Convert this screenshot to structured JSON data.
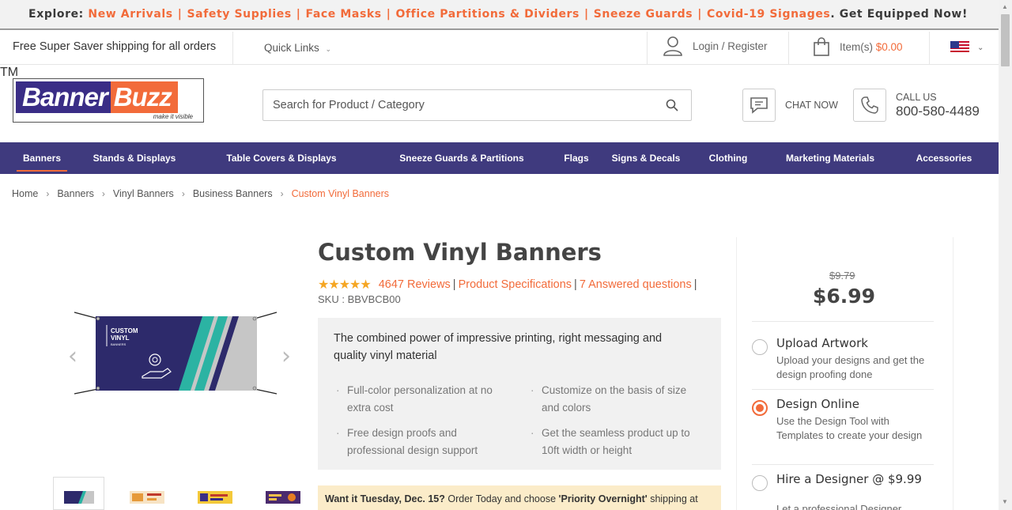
{
  "topbar": {
    "explore": "Explore:",
    "links": [
      "New Arrivals",
      "Safety Supplies",
      "Face Masks",
      "Office Partitions & Dividers",
      "Sneeze Guards",
      "Covid-19 Signages"
    ],
    "cta": "Get Equipped Now!"
  },
  "util": {
    "shipping": "Free Super Saver shipping for all orders",
    "quick_links": "Quick Links",
    "login": "Login / Register",
    "cart_label": "Item(s)",
    "cart_amount": "$0.00"
  },
  "header": {
    "logo_part1": "Banner",
    "logo_part2": "Buzz",
    "logo_tagline": "make it visible",
    "logo_tm": "TM",
    "search_placeholder": "Search for Product / Category",
    "chat": "CHAT NOW",
    "call_label": "CALL US",
    "call_number": "800-580-4489"
  },
  "nav": [
    "Banners",
    "Stands & Displays",
    "Table Covers & Displays",
    "Sneeze Guards & Partitions",
    "Flags",
    "Signs & Decals",
    "Clothing",
    "Marketing Materials",
    "Accessories"
  ],
  "breadcrumb": [
    "Home",
    "Banners",
    "Vinyl Banners",
    "Business Banners",
    "Custom Vinyl Banners"
  ],
  "product": {
    "title": "Custom Vinyl Banners",
    "stars": "★★★★★",
    "reviews": "4647 Reviews",
    "specs": "Product Specifications",
    "questions": "7 Answered questions",
    "sku": "SKU : BBVBCB00",
    "banner_text1": "CUSTOM",
    "banner_text2": "VINYL",
    "banner_text3": "BANNERS",
    "features_head": "The combined power of impressive printing, right messaging and quality vinyl material",
    "features": [
      "Full-color personalization at no extra cost",
      "Customize on the basis of size and colors",
      "Free design proofs and professional design support",
      "Get the seamless product up to 10ft width or height"
    ],
    "promo_bold": "Want it Tuesday, Dec. 15?",
    "promo_mid": " Order Today and choose ",
    "promo_bold2": "'Priority Overnight'",
    "promo_end": " shipping at"
  },
  "pricing": {
    "old_price": "$9.79",
    "price": "$6.99",
    "options": [
      {
        "title": "Upload Artwork",
        "desc": "Upload your designs and get the design proofing done",
        "selected": false
      },
      {
        "title": "Design Online",
        "desc": "Use the Design Tool with Templates to create your design",
        "selected": true
      },
      {
        "title": "Hire a Designer @ $9.99",
        "desc": "Let a professional Designer",
        "selected": false
      }
    ]
  },
  "colors": {
    "accent": "#f26b3a",
    "nav_bg": "#3f3a7e",
    "brand_blue": "#3a2d86",
    "teal": "#2bb3a3",
    "star": "#f5a623"
  }
}
